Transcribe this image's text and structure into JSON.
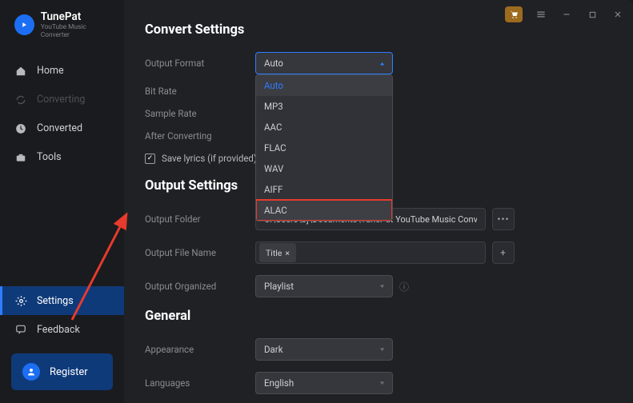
{
  "brand": {
    "title": "TunePat",
    "subtitle": "YouTube Music Converter"
  },
  "window_icons": {
    "cart": "shopping-cart",
    "menu": "hamburger",
    "minimize": "–",
    "maximize": "□",
    "close": "✕"
  },
  "sidebar": {
    "items": [
      {
        "label": "Home",
        "icon": "home-icon"
      },
      {
        "label": "Converting",
        "icon": "refresh-icon"
      },
      {
        "label": "Converted",
        "icon": "clock-icon"
      },
      {
        "label": "Tools",
        "icon": "toolbox-icon"
      }
    ],
    "bottom": [
      {
        "label": "Settings",
        "icon": "gear-icon"
      },
      {
        "label": "Feedback",
        "icon": "chat-icon"
      }
    ],
    "register_label": "Register"
  },
  "sections": {
    "convert": {
      "title": "Convert Settings",
      "output_format": {
        "label": "Output Format",
        "value": "Auto",
        "options": [
          "Auto",
          "MP3",
          "AAC",
          "FLAC",
          "WAV",
          "AIFF",
          "ALAC"
        ],
        "highlighted": "ALAC"
      },
      "bit_rate": {
        "label": "Bit Rate"
      },
      "sample_rate": {
        "label": "Sample Rate"
      },
      "after_converting": {
        "label": "After Converting"
      },
      "save_lyrics": {
        "label": "Save lyrics (if provided)",
        "checked": true
      }
    },
    "output": {
      "title": "Output Settings",
      "folder": {
        "label": "Output Folder",
        "value": "C:\\Users\\bj\\Documents\\TunePat YouTube Music Converter"
      },
      "filename": {
        "label": "Output File Name",
        "tag": "Title",
        "tag_close": "×",
        "add": "+"
      },
      "organized": {
        "label": "Output Organized",
        "value": "Playlist"
      }
    },
    "general": {
      "title": "General",
      "appearance": {
        "label": "Appearance",
        "value": "Dark"
      },
      "languages": {
        "label": "Languages",
        "value": "English"
      }
    }
  }
}
